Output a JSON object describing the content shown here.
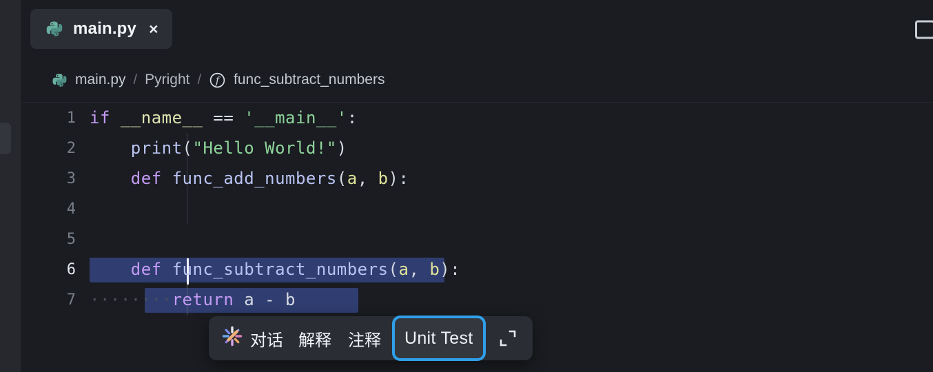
{
  "window": {
    "background": "#1a1c21",
    "sidebar_background": "#26282d"
  },
  "tab": {
    "label": "main.py",
    "icon": "python-icon",
    "close_label": "×"
  },
  "toolbar_right": {
    "split_editor_icon": "split-editor-icon"
  },
  "breadcrumb": {
    "file_icon": "python-icon",
    "items": [
      {
        "label": "main.py"
      },
      {
        "label": "Pyright"
      },
      {
        "label": "func_subtract_numbers",
        "icon": "function-icon"
      }
    ],
    "separator": "/"
  },
  "editor": {
    "active_line": 6,
    "cursor_line": 6,
    "selection_color": "#2f3d70",
    "lines": [
      {
        "number": "1",
        "tokens": [
          {
            "text": "if ",
            "type": "kw"
          },
          {
            "text": "__name__",
            "type": "var"
          },
          {
            "text": " == ",
            "type": "op"
          },
          {
            "text": "'__main__'",
            "type": "str"
          },
          {
            "text": ":",
            "type": "pun"
          }
        ]
      },
      {
        "number": "2",
        "tokens": [
          {
            "text": "    ",
            "type": "plain"
          },
          {
            "text": "print",
            "type": "fn"
          },
          {
            "text": "(",
            "type": "pun"
          },
          {
            "text": "\"Hello World!\"",
            "type": "str"
          },
          {
            "text": ")",
            "type": "pun"
          }
        ]
      },
      {
        "number": "3",
        "tokens": [
          {
            "text": "    ",
            "type": "plain"
          },
          {
            "text": "def ",
            "type": "kw"
          },
          {
            "text": "func_add_numbers",
            "type": "fn"
          },
          {
            "text": "(",
            "type": "pun"
          },
          {
            "text": "a",
            "type": "prm"
          },
          {
            "text": ", ",
            "type": "pun"
          },
          {
            "text": "b",
            "type": "prm"
          },
          {
            "text": "):",
            "type": "pun"
          }
        ]
      },
      {
        "number": "4",
        "tokens": []
      },
      {
        "number": "5",
        "tokens": []
      },
      {
        "number": "6",
        "selected": true,
        "tokens": [
          {
            "text": "    ",
            "type": "plain"
          },
          {
            "text": "def ",
            "type": "kw"
          },
          {
            "text": "func_subtract_numbers",
            "type": "fn"
          },
          {
            "text": "(",
            "type": "pun"
          },
          {
            "text": "a",
            "type": "prm"
          },
          {
            "text": ", ",
            "type": "pun"
          },
          {
            "text": "b",
            "type": "prm"
          },
          {
            "text": "):",
            "type": "pun"
          }
        ]
      },
      {
        "number": "7",
        "selected": true,
        "tokens": [
          {
            "text": "········",
            "type": "ws"
          },
          {
            "text": "return ",
            "type": "kw"
          },
          {
            "text": "a - b",
            "type": "plain"
          }
        ]
      }
    ]
  },
  "ai_toolbar": {
    "sparkle_icon": "ai-sparkle-icon",
    "items": [
      {
        "label": "对话",
        "highlighted": false
      },
      {
        "label": "解释",
        "highlighted": false
      },
      {
        "label": "注释",
        "highlighted": false
      },
      {
        "label": "Unit Test",
        "highlighted": true
      }
    ],
    "expand_icon": "expand-collapse-icon",
    "highlight_color": "#2f9fe8"
  }
}
